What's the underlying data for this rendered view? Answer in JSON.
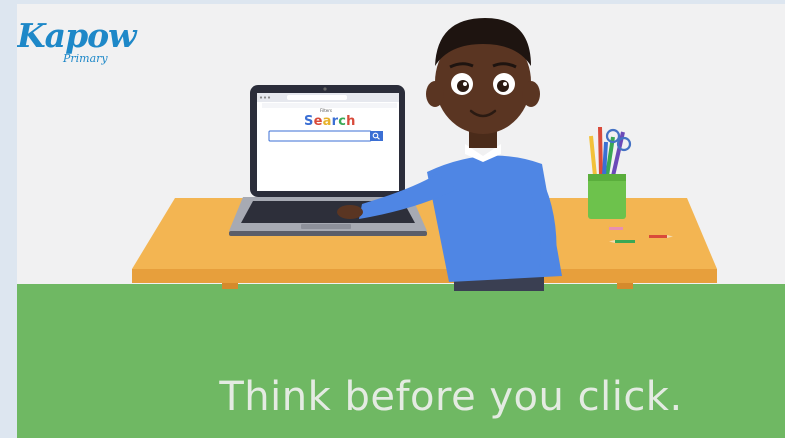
{
  "brand": {
    "name": "Kapow",
    "subtitle": "Primary"
  },
  "laptop": {
    "search_header": "Filters",
    "search_title": [
      "S",
      "e",
      "a",
      "r",
      "c",
      "h"
    ]
  },
  "caption": "Think before you click.",
  "colors": {
    "background": "#f1f1f2",
    "desk": "#f3b552",
    "floor": "#6fb863",
    "jumper": "#4f86e4",
    "skin": "#5a3522",
    "brand": "#1e88c8"
  }
}
